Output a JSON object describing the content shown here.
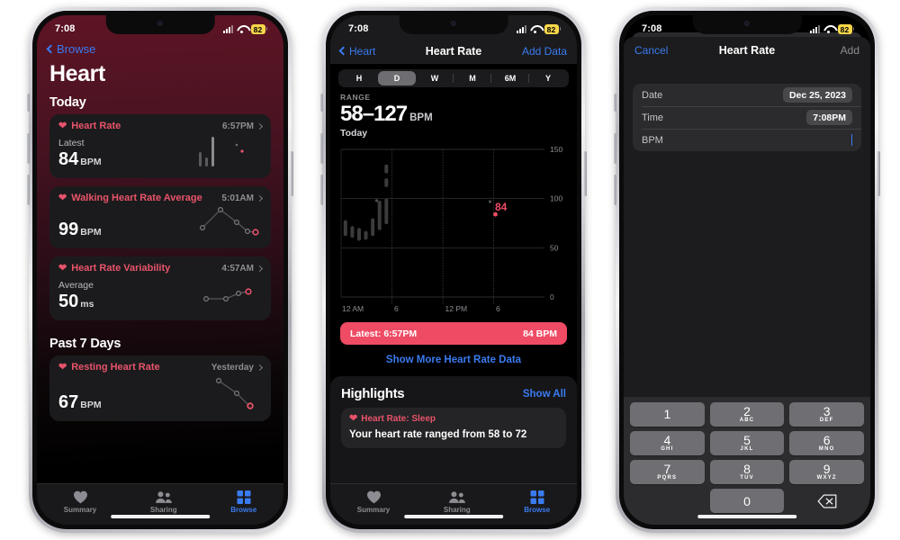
{
  "statusbar": {
    "time": "7:08",
    "battery": "82",
    "signal_icon": "cellular-signal-icon",
    "wifi_icon": "wifi-icon"
  },
  "phone1": {
    "back_label": "Browse",
    "title": "Heart",
    "section_today": "Today",
    "section_past7": "Past 7 Days",
    "cards": [
      {
        "title": "Heart Rate",
        "time": "6:57PM",
        "sub": "Latest",
        "value": "84",
        "unit": "BPM",
        "chart": "bars"
      },
      {
        "title": "Walking Heart Rate Average",
        "time": "5:01AM",
        "sub": "",
        "value": "99",
        "unit": "BPM",
        "chart": "line-peak"
      },
      {
        "title": "Heart Rate Variability",
        "time": "4:57AM",
        "sub": "Average",
        "value": "50",
        "unit": "ms",
        "chart": "line-rise"
      },
      {
        "title": "Resting Heart Rate",
        "time": "Yesterday",
        "sub": "",
        "value": "67",
        "unit": "BPM",
        "chart": "line-fall"
      }
    ],
    "tabs": [
      {
        "label": "Summary",
        "icon": "heart-icon",
        "active": false
      },
      {
        "label": "Sharing",
        "icon": "people-icon",
        "active": false
      },
      {
        "label": "Browse",
        "icon": "grid-icon",
        "active": true
      }
    ]
  },
  "phone2": {
    "back_label": "Heart",
    "nav_title": "Heart Rate",
    "add_data_label": "Add Data",
    "segments": [
      {
        "label": "H",
        "selected": false
      },
      {
        "label": "D",
        "selected": true
      },
      {
        "label": "W",
        "selected": false
      },
      {
        "label": "M",
        "selected": false
      },
      {
        "label": "6M",
        "selected": false
      },
      {
        "label": "Y",
        "selected": false
      }
    ],
    "range_label": "RANGE",
    "range_value": "58–127",
    "range_unit": "BPM",
    "range_day": "Today",
    "latest_label": "Latest: 6:57PM",
    "latest_value": "84 BPM",
    "show_more": "Show More Heart Rate Data",
    "highlights_title": "Highlights",
    "show_all": "Show All",
    "highlight_card_title": "Heart Rate: Sleep",
    "highlight_card_body": "Your heart rate ranged from 58 to 72",
    "tabs": [
      {
        "label": "Summary",
        "icon": "heart-icon",
        "active": false
      },
      {
        "label": "Sharing",
        "icon": "people-icon",
        "active": false
      },
      {
        "label": "Browse",
        "icon": "grid-icon",
        "active": true
      }
    ]
  },
  "phone3": {
    "cancel_label": "Cancel",
    "nav_title": "Heart Rate",
    "add_label": "Add",
    "fields": [
      {
        "label": "Date",
        "value": "Dec 25, 2023",
        "type": "chip"
      },
      {
        "label": "Time",
        "value": "7:08PM",
        "type": "chip"
      },
      {
        "label": "BPM",
        "value": "",
        "type": "input"
      }
    ],
    "keypad": [
      [
        {
          "n": "1",
          "s": ""
        },
        {
          "n": "2",
          "s": "ABC"
        },
        {
          "n": "3",
          "s": "DEF"
        }
      ],
      [
        {
          "n": "4",
          "s": "GHI"
        },
        {
          "n": "5",
          "s": "JKL"
        },
        {
          "n": "6",
          "s": "MNO"
        }
      ],
      [
        {
          "n": "7",
          "s": "PQRS"
        },
        {
          "n": "8",
          "s": "TUV"
        },
        {
          "n": "9",
          "s": "WXYZ"
        }
      ]
    ],
    "key_zero": "0",
    "key_delete_icon": "delete-backward-icon"
  },
  "chart_data": {
    "type": "bar",
    "title": "Today",
    "subtitle": "RANGE 58–127 BPM",
    "xlabel": "",
    "ylabel": "BPM",
    "ylim": [
      0,
      150
    ],
    "yticks": [
      0,
      50,
      100,
      150
    ],
    "xticks": [
      "12 AM",
      "6",
      "12 PM",
      "6"
    ],
    "grid": true,
    "legend": "none",
    "annotations": [
      {
        "label": "84",
        "x_hour": 18.2,
        "y": 84,
        "color": "#ef4b64"
      }
    ],
    "series": [
      {
        "name": "Heart Rate Range (floating bars)",
        "type": "range-bar",
        "color": "#3a3a3c",
        "points": [
          {
            "x_hour": 0.3,
            "low": 62,
            "high": 78
          },
          {
            "x_hour": 1.1,
            "low": 60,
            "high": 72
          },
          {
            "x_hour": 1.9,
            "low": 57,
            "high": 70
          },
          {
            "x_hour": 2.7,
            "low": 58,
            "high": 67
          },
          {
            "x_hour": 3.5,
            "low": 62,
            "high": 80
          },
          {
            "x_hour": 4.3,
            "low": 68,
            "high": 98
          },
          {
            "x_hour": 4.9,
            "low": 74,
            "high": 100
          },
          {
            "x_hour": 5.0,
            "low": 103,
            "high": 112
          },
          {
            "x_hour": 5.0,
            "low": 118,
            "high": 127
          }
        ]
      },
      {
        "name": "Single readings",
        "type": "scatter",
        "color": "#4a4a4c",
        "points": [
          {
            "x_hour": 4.2,
            "y": 98
          },
          {
            "x_hour": 17.6,
            "y": 97
          }
        ]
      },
      {
        "name": "Latest reading",
        "type": "scatter",
        "color": "#ef4b64",
        "points": [
          {
            "x_hour": 18.2,
            "y": 84
          }
        ]
      }
    ]
  }
}
